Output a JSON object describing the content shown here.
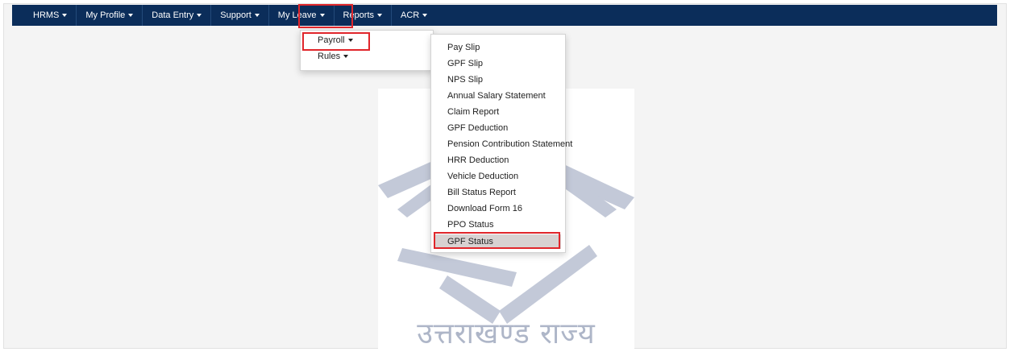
{
  "navbar": {
    "items": [
      {
        "label": "HRMS"
      },
      {
        "label": "My Profile"
      },
      {
        "label": "Data Entry"
      },
      {
        "label": "Support"
      },
      {
        "label": "My Leave"
      },
      {
        "label": "Reports"
      },
      {
        "label": "ACR"
      }
    ],
    "background_color": "#0b2d5a",
    "text_color": "#ffffff"
  },
  "reports_menu": {
    "items": [
      {
        "label": "Payroll"
      },
      {
        "label": "Rules"
      }
    ]
  },
  "payroll_menu": {
    "items": [
      {
        "label": "Pay Slip"
      },
      {
        "label": "GPF Slip"
      },
      {
        "label": "NPS Slip"
      },
      {
        "label": "Annual Salary Statement"
      },
      {
        "label": "Claim Report"
      },
      {
        "label": "GPF Deduction"
      },
      {
        "label": "Pension Contribution Statement"
      },
      {
        "label": "HRR Deduction"
      },
      {
        "label": "Vehicle Deduction"
      },
      {
        "label": "Bill Status Report"
      },
      {
        "label": "Download Form 16"
      },
      {
        "label": "PPO Status"
      },
      {
        "label": "GPF Status"
      }
    ],
    "selected": "GPF Status"
  },
  "emblem": {
    "text": "उत्तराखण्ड राज्य",
    "icon": "uttarakhand-emblem-icon"
  },
  "colors": {
    "highlight_box": "#e0262b",
    "selected_row": "#d8d2d2"
  }
}
